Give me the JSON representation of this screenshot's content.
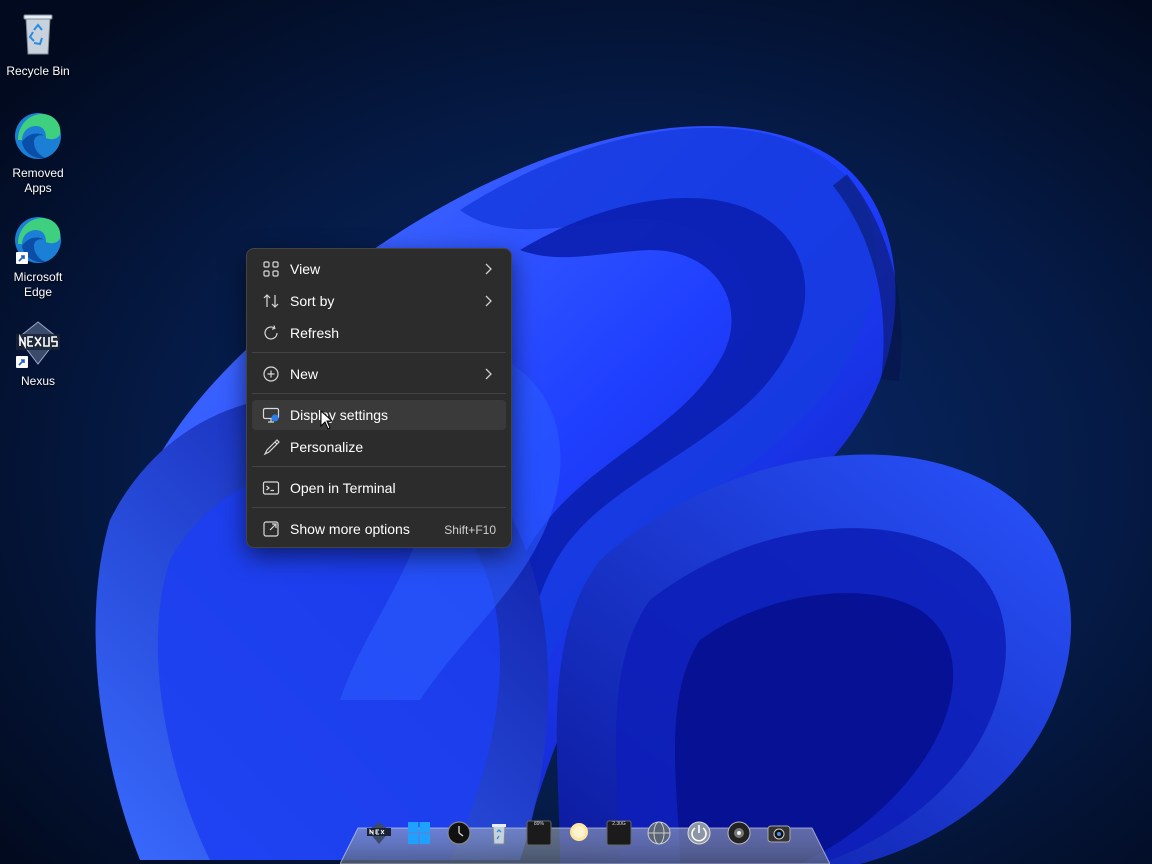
{
  "desktop_icons": [
    {
      "label": "Recycle Bin",
      "icon": "recycle-bin-icon"
    },
    {
      "label": "Removed\nApps",
      "icon": "edge-icon"
    },
    {
      "label": "Microsoft\nEdge",
      "icon": "edge-icon"
    },
    {
      "label": "Nexus",
      "icon": "nexus-icon"
    }
  ],
  "context_menu": {
    "view": {
      "label": "View",
      "icon": "grid-icon"
    },
    "sort_by": {
      "label": "Sort by",
      "icon": "sort-icon"
    },
    "refresh": {
      "label": "Refresh",
      "icon": "refresh-icon"
    },
    "new": {
      "label": "New",
      "icon": "plus-circle-icon"
    },
    "display_settings": {
      "label": "Display settings",
      "icon": "display-icon"
    },
    "personalize": {
      "label": "Personalize",
      "icon": "brush-icon"
    },
    "open_terminal": {
      "label": "Open in Terminal",
      "icon": "terminal-icon"
    },
    "show_more": {
      "label": "Show more options",
      "icon": "share-icon",
      "shortcut": "Shift+F10"
    }
  },
  "dock": {
    "items": [
      "nexus-icon",
      "windows-icon",
      "clock-icon",
      "recycle-bin-icon",
      "cpu-meter-icon",
      "weather-icon",
      "net-meter-icon",
      "globe-icon",
      "power-icon",
      "music-icon",
      "camera-icon"
    ],
    "cpu_meter_text": "89%",
    "net_meter_text": "2.30G"
  },
  "colors": {
    "menu_bg": "#2c2c2c",
    "menu_hover": "#3a3a3a",
    "accent_blue": "#1f4fff",
    "desktop_bg": "#041432"
  }
}
